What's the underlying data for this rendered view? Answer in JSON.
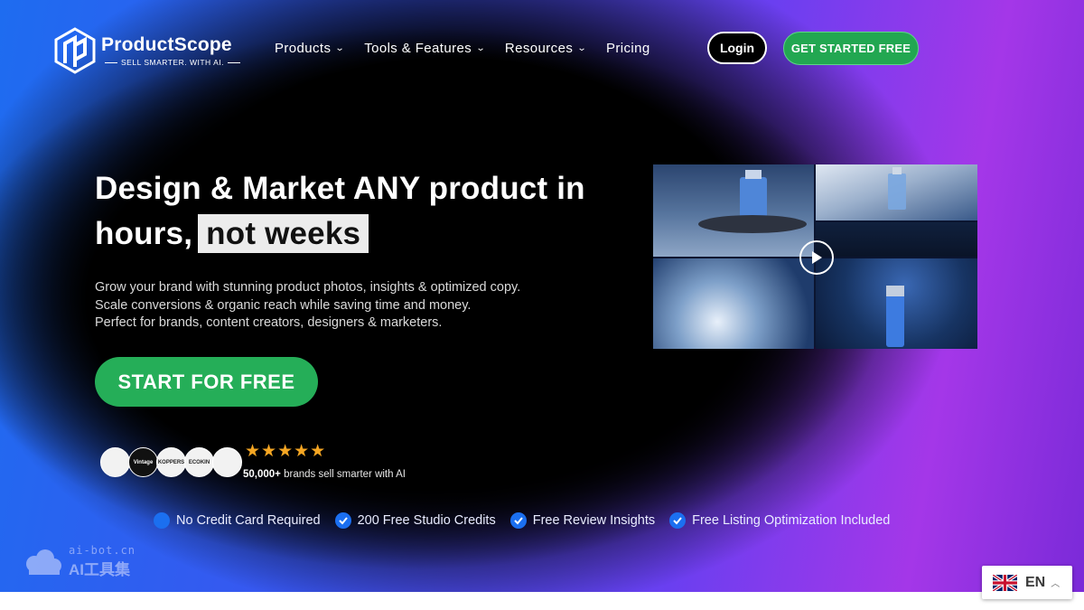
{
  "header": {
    "brand": "ProductScope",
    "tagline": "SELL SMARTER. WITH AI.",
    "nav": [
      {
        "label": "Products",
        "has_dropdown": true
      },
      {
        "label": "Tools & Features",
        "has_dropdown": true
      },
      {
        "label": "Resources",
        "has_dropdown": true
      },
      {
        "label": "Pricing",
        "has_dropdown": false
      }
    ],
    "login_label": "Login",
    "cta_label": "GET STARTED FREE"
  },
  "hero": {
    "headline_line1": "Design & Market ANY product in",
    "headline_line2_prefix": "hours,",
    "headline_highlight": "not weeks",
    "sub_lines": [
      "Grow your brand with stunning product photos, insights & optimized copy.",
      "Scale conversions & organic reach while saving time and money.",
      "Perfect for brands, content creators, designers & marketers."
    ],
    "start_button": "START FOR FREE",
    "rating_stars": "★★★★★",
    "rating_value": 5,
    "social_count": "50,000+",
    "social_text": "brands sell smarter with AI",
    "brand_logos": [
      "",
      "Vintage",
      "KOPPERS",
      "ECOKIN",
      ""
    ]
  },
  "features": [
    "No Credit Card Required",
    "200 Free Studio Credits",
    "Free Review Insights",
    "Free Listing Optimization Included"
  ],
  "watermark": {
    "url": "ai-bot.cn",
    "name": "AI工具集"
  },
  "language": {
    "code": "EN"
  },
  "colors": {
    "green": "#25ae58",
    "blue": "#1b6ff0",
    "star": "#f5a623"
  }
}
